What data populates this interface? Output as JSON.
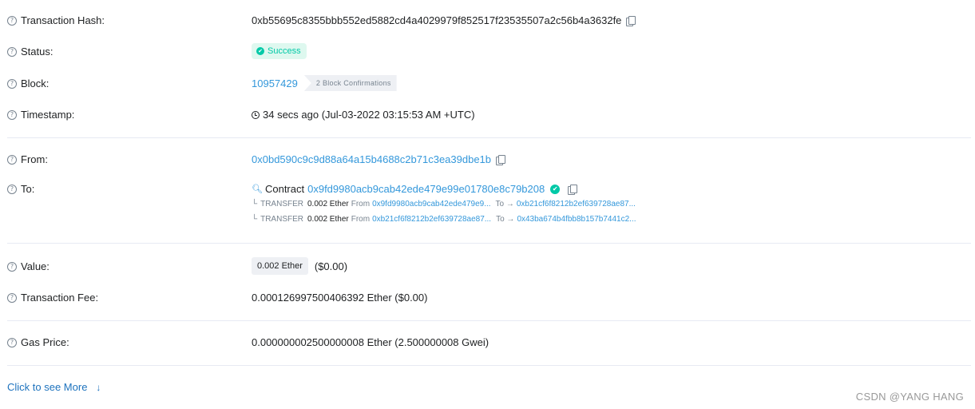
{
  "fields": {
    "tx_hash": {
      "label": "Transaction Hash:",
      "value": "0xb55695c8355bbb552ed5882cd4a4029979f852517f23535507a2c56b4a3632fe"
    },
    "status": {
      "label": "Status:",
      "value": "Success"
    },
    "block": {
      "label": "Block:",
      "number": "10957429",
      "confirmations": "2 Block Confirmations"
    },
    "timestamp": {
      "label": "Timestamp:",
      "value": "34 secs ago (Jul-03-2022 03:15:53 AM +UTC)"
    },
    "from": {
      "label": "From:",
      "address": "0x0bd590c9c9d88a64a15b4688c2b71c3ea39dbe1b"
    },
    "to": {
      "label": "To:",
      "contract_prefix": "Contract",
      "address": "0x9fd9980acb9cab42ede479e99e01780e8c79b208",
      "transfers": [
        {
          "type": "TRANSFER",
          "amount": "0.002 Ether",
          "from_label": "From",
          "from": "0x9fd9980acb9cab42ede479e9...",
          "to_label": "To →",
          "to": "0xb21cf6f8212b2ef639728ae87..."
        },
        {
          "type": "TRANSFER",
          "amount": "0.002 Ether",
          "from_label": "From",
          "from": "0xb21cf6f8212b2ef639728ae87...",
          "to_label": "To →",
          "to": "0x43ba674b4fbb8b157b7441c2..."
        }
      ]
    },
    "value": {
      "label": "Value:",
      "amount": "0.002 Ether",
      "usd": "($0.00)"
    },
    "fee": {
      "label": "Transaction Fee:",
      "value": "0.000126997500406392 Ether ($0.00)"
    },
    "gas_price": {
      "label": "Gas Price:",
      "value": "0.000000002500000008 Ether (2.500000008 Gwei)"
    }
  },
  "more_link": "Click to see More",
  "watermark": "CSDN @YANG HANG",
  "icons": {
    "help": "question-circle-icon",
    "copy": "copy-icon",
    "check": "check-circle-icon",
    "clock": "clock-icon",
    "search": "search-contract-icon",
    "down": "arrow-down-icon"
  },
  "colors": {
    "link": "#3498db",
    "success": "#00c9a7",
    "success_bg": "#def8ef",
    "muted": "#77838f"
  }
}
